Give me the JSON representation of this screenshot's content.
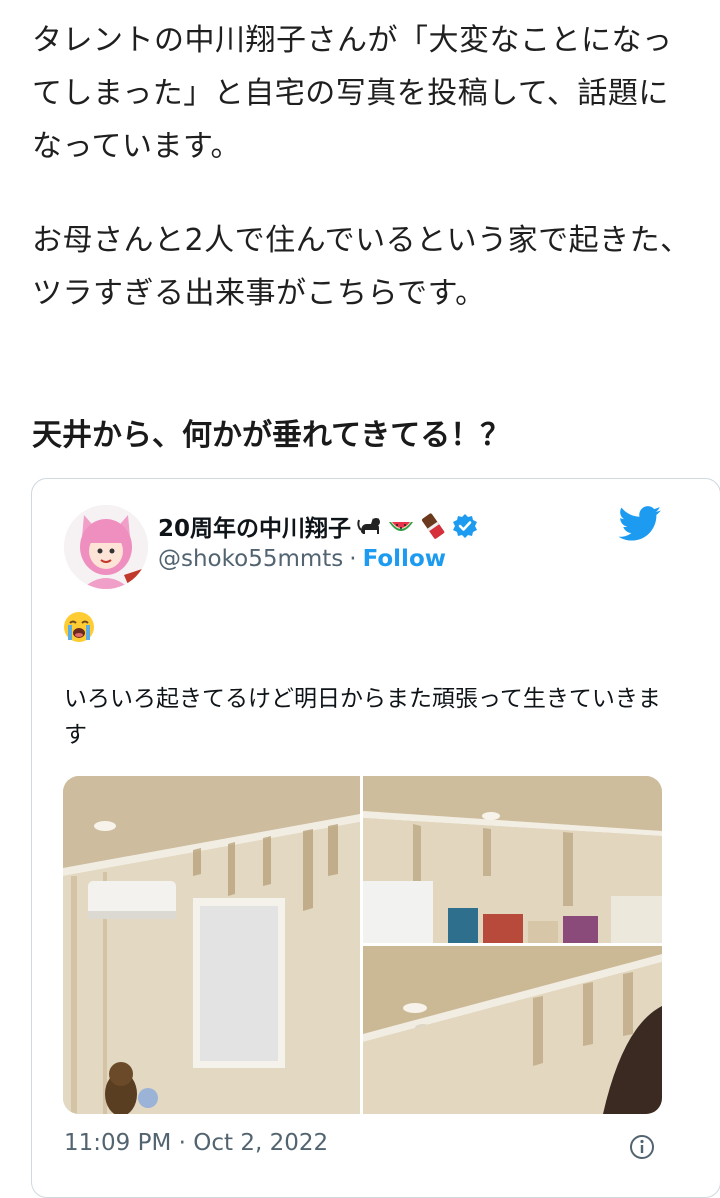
{
  "article": {
    "paragraph1": "タレントの中川翔子さんが「大変なことになってしまった」と自宅の写真を投稿して、話題になっています。",
    "paragraph2": "お母さんと2人で住んでいるという家で起きた、ツラすぎる出来事がこちらです。",
    "heading": "天井から、何かが垂れてきてる！？"
  },
  "tweet": {
    "display_name": "20周年の中川翔子",
    "name_emojis": [
      "cat-icon",
      "watermelon-icon",
      "chocolate-icon"
    ],
    "verified_icon": "verified-badge-icon",
    "handle": "@shoko55mmts",
    "separator": "·",
    "follow_label": "Follow",
    "emoji_line_icon": "crying-face-icon",
    "text": "いろいろ起きてるけど明日からまた頑張って生きていきます",
    "timestamp": "11:09 PM · Oct 2, 2022",
    "photos": [
      "photo-1",
      "photo-2",
      "photo-3"
    ]
  },
  "colors": {
    "twitter_blue": "#1d9bf0",
    "secondary_text": "#536471",
    "card_border": "#cfd9de"
  }
}
